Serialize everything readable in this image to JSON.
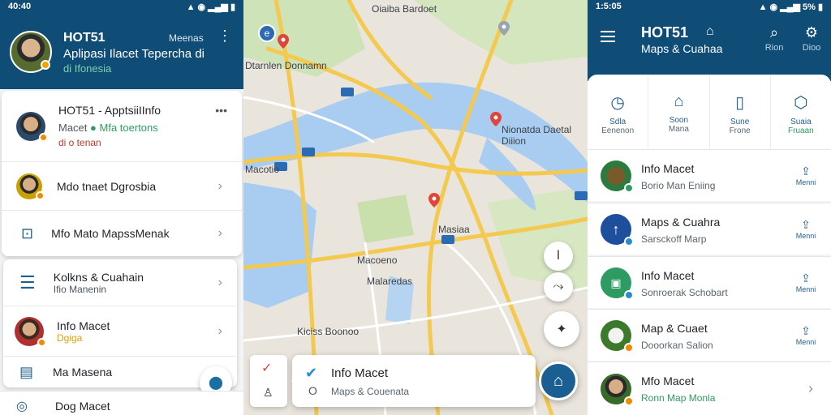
{
  "left": {
    "status_time": "40:40",
    "header": {
      "title": "HOT51",
      "action": "Meenas",
      "subtitle": "Aplipasi Ilacet Tepercha di",
      "region": "di Ifonesia"
    },
    "card1": [
      {
        "title": "HOT51 - ApptsiiIInfo",
        "sub": "Macet",
        "sub_green": "Mfa toertons",
        "sub2": "di o tenan"
      },
      {
        "title": "Mdo tnaet Dgrosbia"
      },
      {
        "title": "Mfo Mato MapssMenak"
      }
    ],
    "card2": [
      {
        "title": "Kolkns & Cuahain",
        "sub": "Ifio Manenin"
      },
      {
        "title": "Info Macet",
        "sub": "Dgiga"
      },
      {
        "title": "Ma Masena"
      }
    ],
    "bottom_peek": "Dog Macet"
  },
  "map": {
    "labels": [
      {
        "text": "Oiaiba Bardoet",
        "key": "top"
      },
      {
        "text": "Dtarnlen Donnamn",
        "key": "a"
      },
      {
        "text": "Nionatda Daetal Diiion",
        "key": "b"
      },
      {
        "text": "Macotio",
        "key": "c"
      },
      {
        "text": "Masiaa",
        "key": "d"
      },
      {
        "text": "Macoeno",
        "key": "e"
      },
      {
        "text": "Malaredas",
        "key": "f"
      },
      {
        "text": "Kiciss Boonoo",
        "key": "g"
      }
    ],
    "sheet": {
      "title": "Info Macet",
      "sub": "Maps & Couenata"
    }
  },
  "right": {
    "status_time": "1:5:05",
    "status_battery": "5%",
    "header": {
      "title": "HOT51",
      "subtitle": "Maps & Cuahaa",
      "btn1": "Rion",
      "btn2": "Dioo"
    },
    "quick": [
      {
        "l1": "Sdla",
        "l2": "Eenenon"
      },
      {
        "l1": "Soon",
        "l2": "Mana"
      },
      {
        "l1": "Sune",
        "l2": "Frone"
      },
      {
        "l1": "Suaia",
        "l2": "Fruaan"
      }
    ],
    "list": [
      {
        "title": "Info Macet",
        "sub": "Borio Man Eniing",
        "action": "Menni"
      },
      {
        "title": "Maps & Cuahra",
        "sub": "Sarsckoff Marp",
        "action": "Menni"
      },
      {
        "title": "Info Macet",
        "sub": "Sonroerak Schobart",
        "action": "Menni"
      },
      {
        "title": "Map & Cuaet",
        "sub": "Dooorkan Salion",
        "action": "Menni"
      },
      {
        "title": "Mfo Macet",
        "sub": "Ronn Map Monla"
      }
    ]
  }
}
